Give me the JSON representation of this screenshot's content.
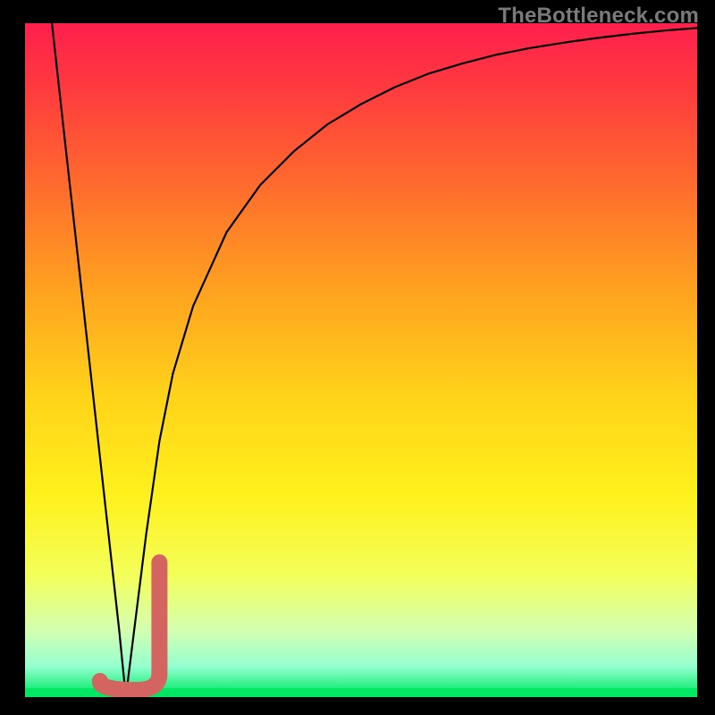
{
  "watermark": "TheBottleneck.com",
  "colors": {
    "frame": "#000000",
    "curve": "#000000",
    "marker": "#d3645f",
    "optimal_band": "#00e863",
    "gradient_stops": [
      {
        "offset": 0.0,
        "color": "#ff1f4d"
      },
      {
        "offset": 0.1,
        "color": "#ff3b3e"
      },
      {
        "offset": 0.25,
        "color": "#ff6f2c"
      },
      {
        "offset": 0.4,
        "color": "#ffa31f"
      },
      {
        "offset": 0.55,
        "color": "#ffd21a"
      },
      {
        "offset": 0.7,
        "color": "#fff11c"
      },
      {
        "offset": 0.82,
        "color": "#f3ff5a"
      },
      {
        "offset": 0.9,
        "color": "#d4ffb0"
      },
      {
        "offset": 0.955,
        "color": "#94ffd0"
      },
      {
        "offset": 0.985,
        "color": "#28ef82"
      },
      {
        "offset": 1.0,
        "color": "#00e863"
      }
    ]
  },
  "chart_data": {
    "type": "line",
    "title": "",
    "xlabel": "",
    "ylabel": "",
    "xlim": [
      0,
      100
    ],
    "ylim": [
      0,
      100
    ],
    "optimal_x": 15,
    "series": [
      {
        "name": "bottleneck_curve",
        "x": [
          4,
          6,
          8,
          10,
          12,
          14,
          15,
          16,
          18,
          20,
          22,
          25,
          30,
          35,
          40,
          45,
          50,
          55,
          60,
          65,
          70,
          75,
          80,
          85,
          90,
          95,
          100
        ],
        "values": [
          100,
          82,
          64,
          46,
          28,
          10,
          0,
          8,
          24,
          38,
          48,
          58,
          69,
          76,
          81,
          85,
          88,
          90.5,
          92.5,
          94,
          95.3,
          96.3,
          97.1,
          97.8,
          98.4,
          98.9,
          99.3
        ]
      }
    ],
    "marker": {
      "shape": "J",
      "x_range": [
        13,
        20
      ],
      "y_range": [
        0,
        20
      ]
    }
  }
}
